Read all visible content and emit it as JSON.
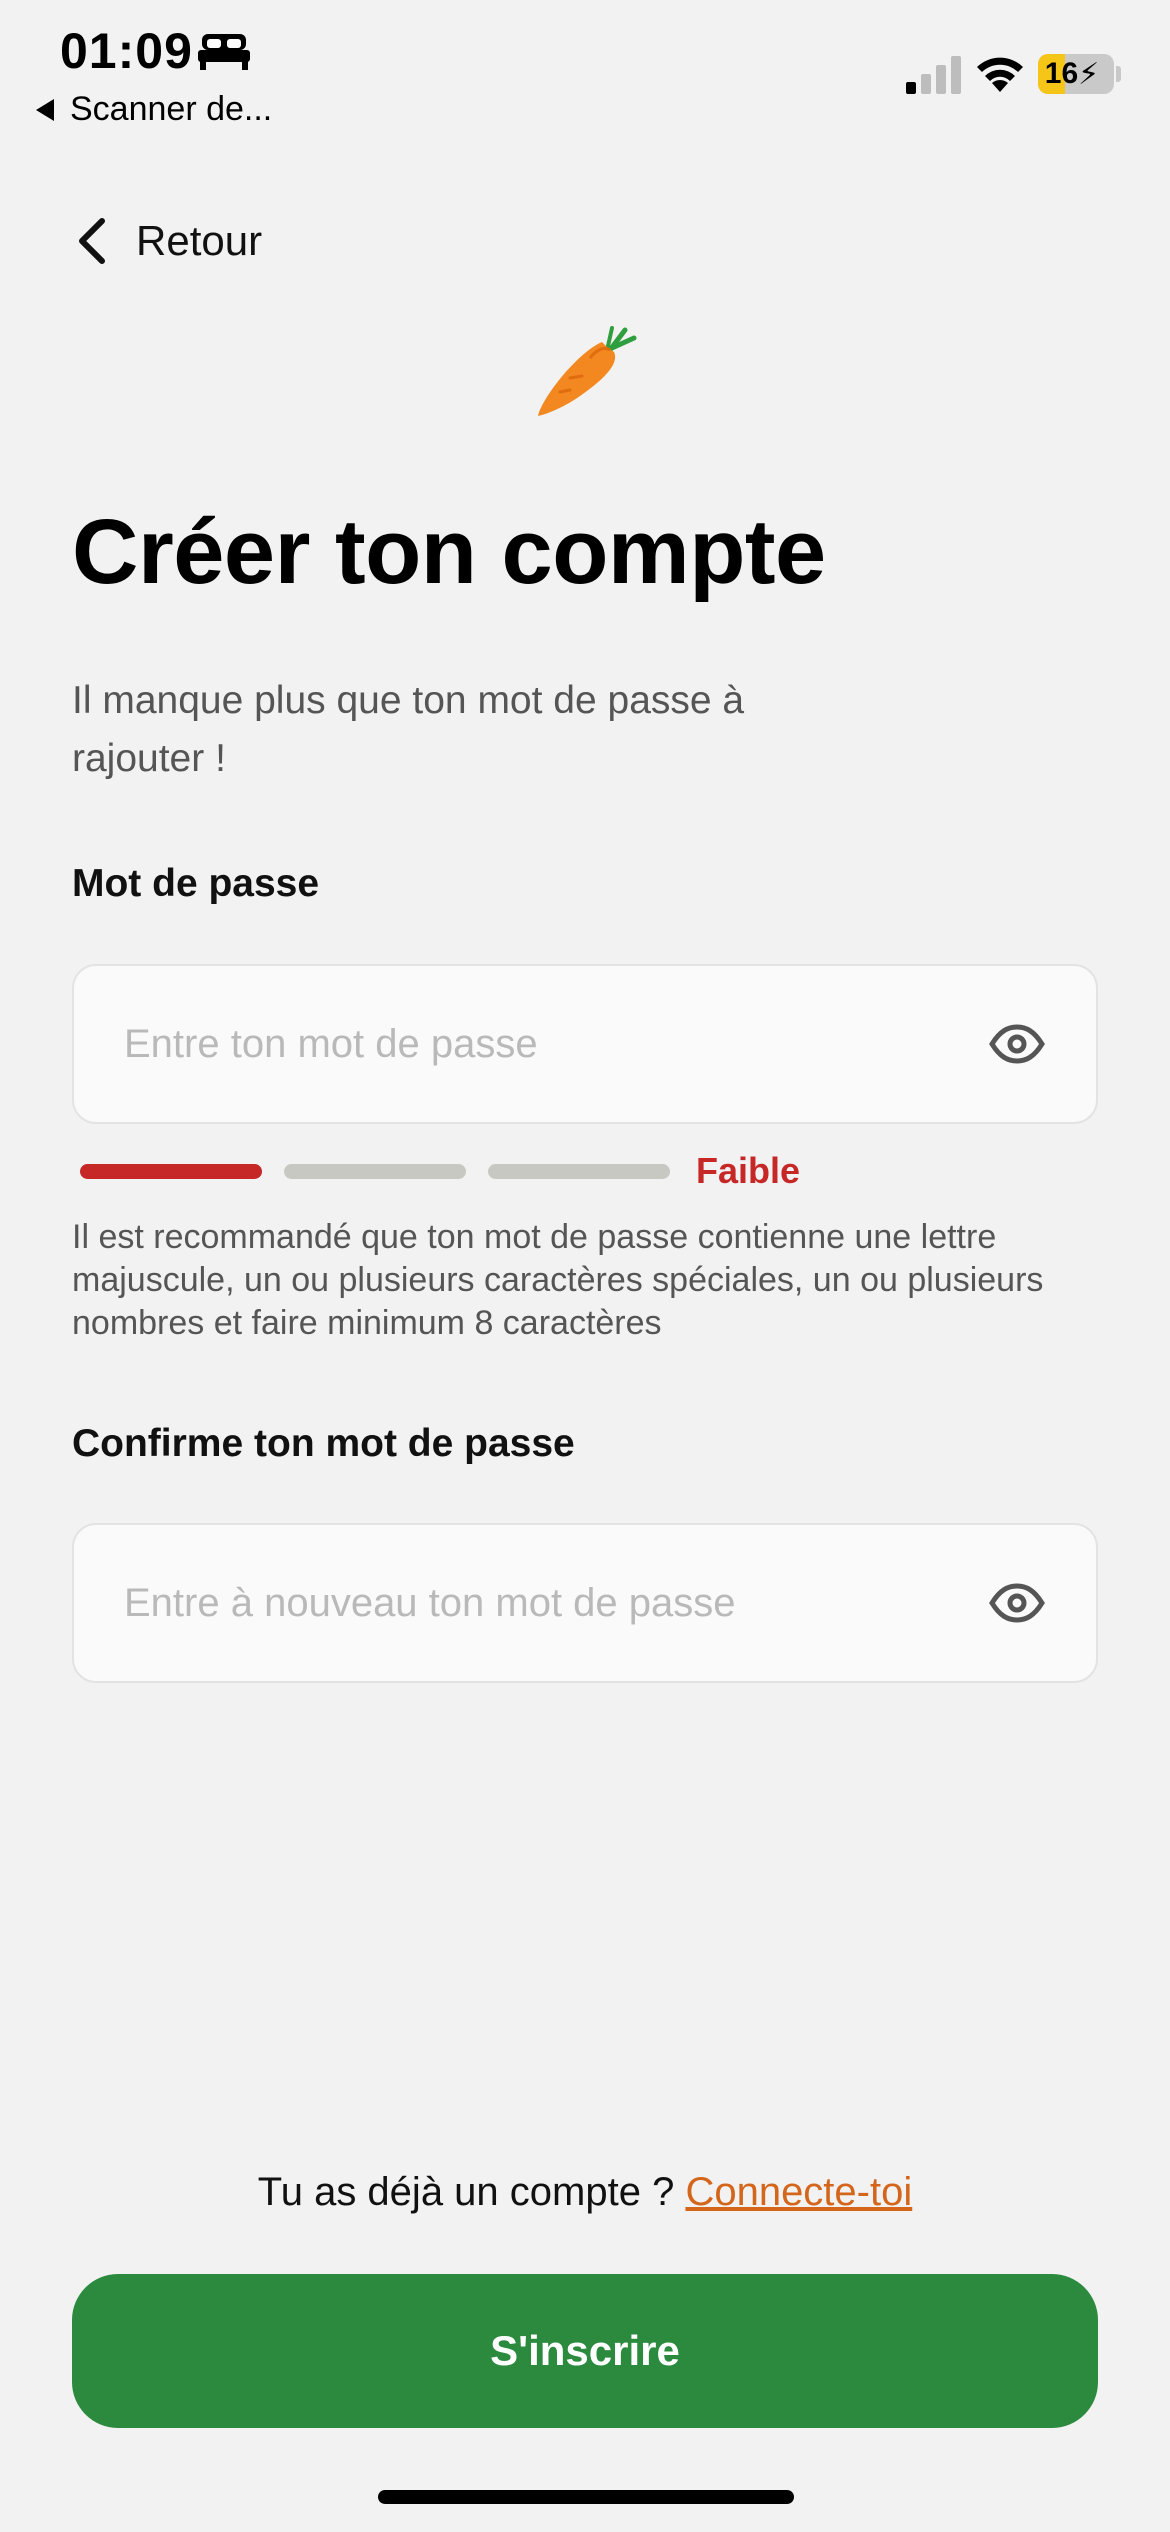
{
  "status_bar": {
    "time": "01:09",
    "back_app": "Scanner de...",
    "battery": "16"
  },
  "nav": {
    "back_label": "Retour"
  },
  "header": {
    "title": "Créer ton compte",
    "subtitle": "Il manque plus que ton mot de passe à rajouter !"
  },
  "password": {
    "label": "Mot de passe",
    "placeholder": "Entre ton mot de passe",
    "strength_label": "Faible",
    "strength_level": 1,
    "strength_max": 3,
    "hint": "Il est recommandé que ton mot de passe contienne une lettre majuscule, un ou plusieurs caractères spéciales, un ou plusieurs nombres et faire minimum 8 caractères"
  },
  "confirm": {
    "label": "Confirme ton mot de passe",
    "placeholder": "Entre à nouveau ton mot de passe"
  },
  "footer": {
    "login_prompt": "Tu as déjà un compte ?",
    "login_link": "Connecte-toi",
    "signup_button": "S'inscrire"
  },
  "colors": {
    "primary_green": "#2b8a3e",
    "link_orange": "#d4661c",
    "weak_red": "#c62828"
  },
  "icons": [
    "bed-icon",
    "signal-icon",
    "wifi-icon",
    "battery-icon",
    "chevron-left-icon",
    "carrot-icon",
    "eye-icon"
  ]
}
